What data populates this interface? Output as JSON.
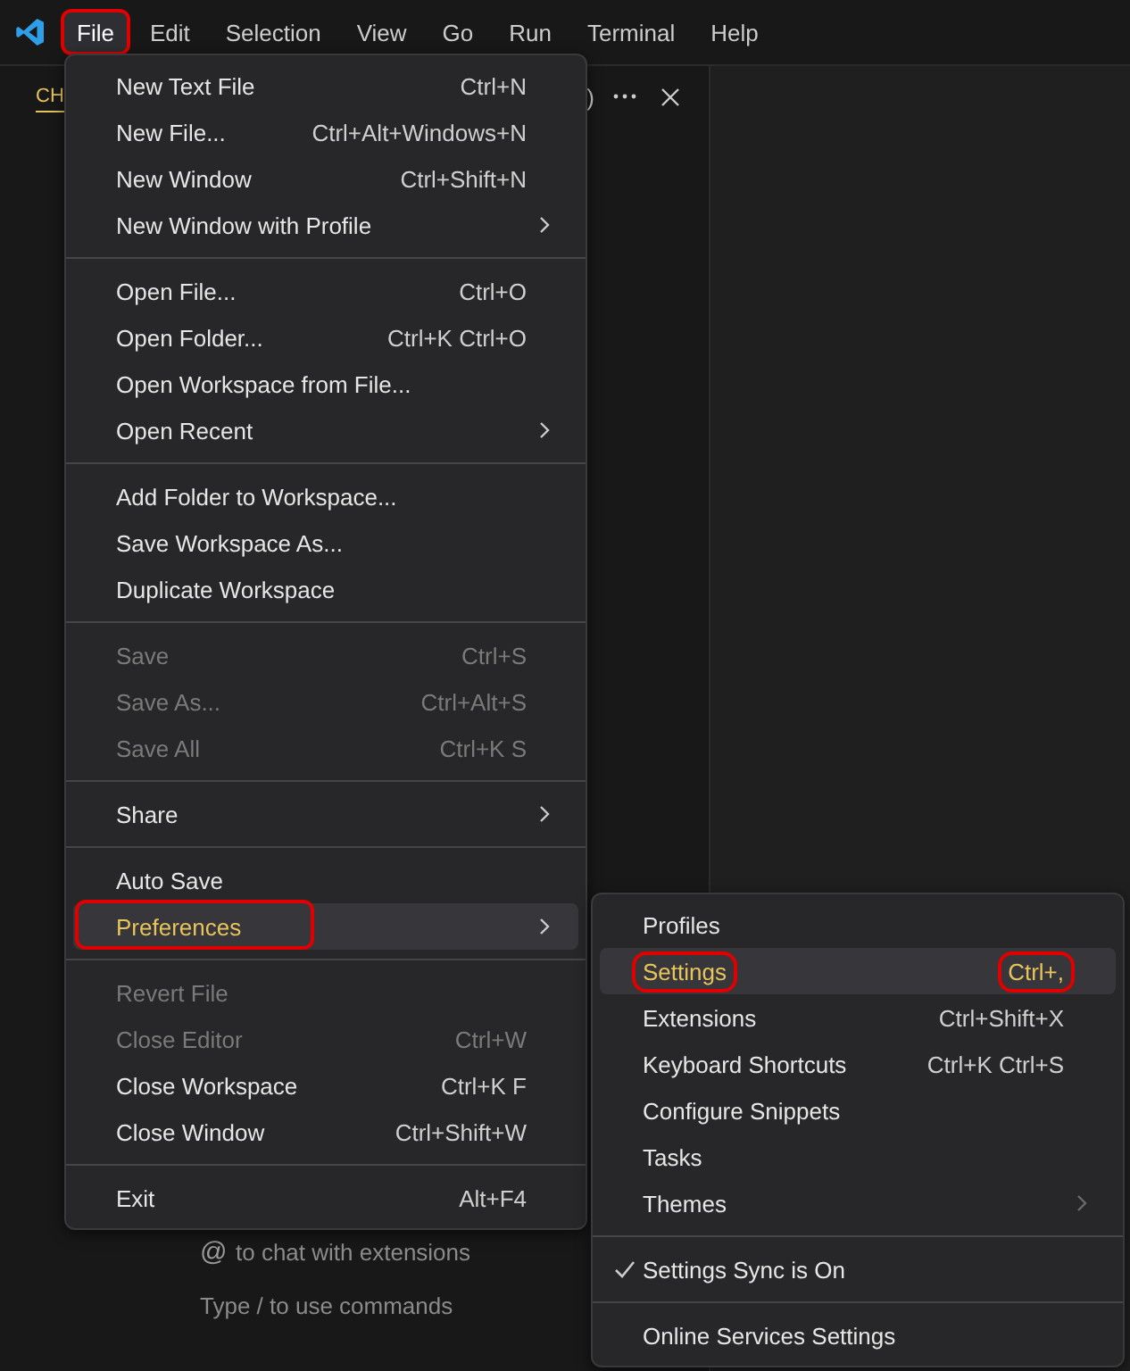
{
  "menubar": [
    {
      "label": "File",
      "selected": true,
      "annotated": true
    },
    {
      "label": "Edit",
      "selected": false,
      "annotated": false
    },
    {
      "label": "Selection",
      "selected": false,
      "annotated": false
    },
    {
      "label": "View",
      "selected": false,
      "annotated": false
    },
    {
      "label": "Go",
      "selected": false,
      "annotated": false
    },
    {
      "label": "Run",
      "selected": false,
      "annotated": false
    },
    {
      "label": "Terminal",
      "selected": false,
      "annotated": false
    },
    {
      "label": "Help",
      "selected": false,
      "annotated": false
    }
  ],
  "sidebar": {
    "tab": "CH",
    "cut_text": ")",
    "hints": [
      {
        "kind": "mention",
        "icon": "@",
        "text": "to chat with extensions"
      },
      {
        "kind": "plain",
        "text": "Type / to use commands"
      }
    ]
  },
  "file_menu": [
    [
      {
        "label": "New Text File",
        "shortcut": "Ctrl+N",
        "submenu": false,
        "disabled": false,
        "selected": false,
        "annotated": false
      },
      {
        "label": "New File...",
        "shortcut": "Ctrl+Alt+Windows+N",
        "submenu": false,
        "disabled": false,
        "selected": false,
        "annotated": false
      },
      {
        "label": "New Window",
        "shortcut": "Ctrl+Shift+N",
        "submenu": false,
        "disabled": false,
        "selected": false,
        "annotated": false
      },
      {
        "label": "New Window with Profile",
        "submenu": true,
        "disabled": false,
        "selected": false,
        "annotated": false
      }
    ],
    [
      {
        "label": "Open File...",
        "shortcut": "Ctrl+O",
        "submenu": false,
        "disabled": false,
        "selected": false,
        "annotated": false
      },
      {
        "label": "Open Folder...",
        "shortcut": "Ctrl+K Ctrl+O",
        "submenu": false,
        "disabled": false,
        "selected": false,
        "annotated": false
      },
      {
        "label": "Open Workspace from File...",
        "submenu": false,
        "disabled": false,
        "selected": false,
        "annotated": false
      },
      {
        "label": "Open Recent",
        "submenu": true,
        "disabled": false,
        "selected": false,
        "annotated": false
      }
    ],
    [
      {
        "label": "Add Folder to Workspace...",
        "submenu": false,
        "disabled": false,
        "selected": false,
        "annotated": false
      },
      {
        "label": "Save Workspace As...",
        "submenu": false,
        "disabled": false,
        "selected": false,
        "annotated": false
      },
      {
        "label": "Duplicate Workspace",
        "submenu": false,
        "disabled": false,
        "selected": false,
        "annotated": false
      }
    ],
    [
      {
        "label": "Save",
        "shortcut": "Ctrl+S",
        "submenu": false,
        "disabled": true,
        "selected": false,
        "annotated": false
      },
      {
        "label": "Save As...",
        "shortcut": "Ctrl+Alt+S",
        "submenu": false,
        "disabled": true,
        "selected": false,
        "annotated": false
      },
      {
        "label": "Save All",
        "shortcut": "Ctrl+K S",
        "submenu": false,
        "disabled": true,
        "selected": false,
        "annotated": false
      }
    ],
    [
      {
        "label": "Share",
        "submenu": true,
        "disabled": false,
        "selected": false,
        "annotated": false
      }
    ],
    [
      {
        "label": "Auto Save",
        "submenu": false,
        "disabled": false,
        "selected": false,
        "annotated": false
      },
      {
        "label": "Preferences",
        "submenu": true,
        "disabled": false,
        "selected": true,
        "annotated": true
      }
    ],
    [
      {
        "label": "Revert File",
        "submenu": false,
        "disabled": true,
        "selected": false,
        "annotated": false
      },
      {
        "label": "Close Editor",
        "shortcut": "Ctrl+W",
        "submenu": false,
        "disabled": true,
        "selected": false,
        "annotated": false
      },
      {
        "label": "Close Workspace",
        "shortcut": "Ctrl+K F",
        "submenu": false,
        "disabled": false,
        "selected": false,
        "annotated": false
      },
      {
        "label": "Close Window",
        "shortcut": "Ctrl+Shift+W",
        "submenu": false,
        "disabled": false,
        "selected": false,
        "annotated": false
      }
    ],
    [
      {
        "label": "Exit",
        "shortcut": "Alt+F4",
        "submenu": false,
        "disabled": false,
        "selected": false,
        "annotated": false
      }
    ]
  ],
  "preferences_menu": [
    [
      {
        "label": "Profiles",
        "submenu": false,
        "checked": false,
        "selected": false,
        "annotated": false
      },
      {
        "label": "Settings",
        "shortcut": "Ctrl+,",
        "submenu": false,
        "checked": false,
        "selected": true,
        "annotated": true,
        "shortcut_annotated": true
      },
      {
        "label": "Extensions",
        "shortcut": "Ctrl+Shift+X",
        "submenu": false,
        "checked": false,
        "selected": false,
        "annotated": false,
        "shortcut_annotated": false
      },
      {
        "label": "Keyboard Shortcuts",
        "shortcut": "Ctrl+K Ctrl+S",
        "submenu": false,
        "checked": false,
        "selected": false,
        "annotated": false,
        "shortcut_annotated": false
      },
      {
        "label": "Configure Snippets",
        "submenu": false,
        "checked": false,
        "selected": false,
        "annotated": false
      },
      {
        "label": "Tasks",
        "submenu": false,
        "checked": false,
        "selected": false,
        "annotated": false
      },
      {
        "label": "Themes",
        "submenu": true,
        "checked": false,
        "selected": false,
        "annotated": false
      }
    ],
    [
      {
        "label": "Settings Sync is On",
        "submenu": false,
        "checked": true,
        "selected": false,
        "annotated": false
      }
    ],
    [
      {
        "label": "Online Services Settings",
        "submenu": false,
        "checked": false,
        "selected": false,
        "annotated": false
      }
    ]
  ]
}
